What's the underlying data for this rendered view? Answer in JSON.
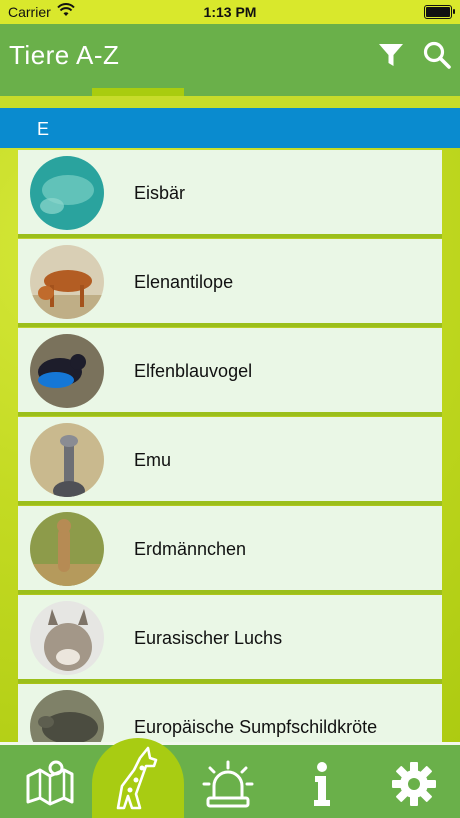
{
  "status_bar": {
    "carrier": "Carrier",
    "time": "1:13 PM"
  },
  "header": {
    "title": "Tiere A-Z"
  },
  "section": {
    "letter": "E"
  },
  "animals": [
    {
      "name": "Eisbär"
    },
    {
      "name": "Elenantilope"
    },
    {
      "name": "Elfenblauvogel"
    },
    {
      "name": "Emu"
    },
    {
      "name": "Erdmännchen"
    },
    {
      "name": "Eurasischer Luchs"
    },
    {
      "name": "Europäische Sumpfschildkröte"
    }
  ],
  "bottom_nav": {
    "items": [
      "map-icon",
      "giraffe-icon",
      "alarm-icon",
      "info-icon",
      "settings-icon"
    ],
    "active": "giraffe-icon"
  },
  "colors": {
    "accent_green": "#6ab04a",
    "lime": "#a8cc12",
    "section_blue": "#0a8bcf",
    "card_bg": "#eaf7e6"
  }
}
